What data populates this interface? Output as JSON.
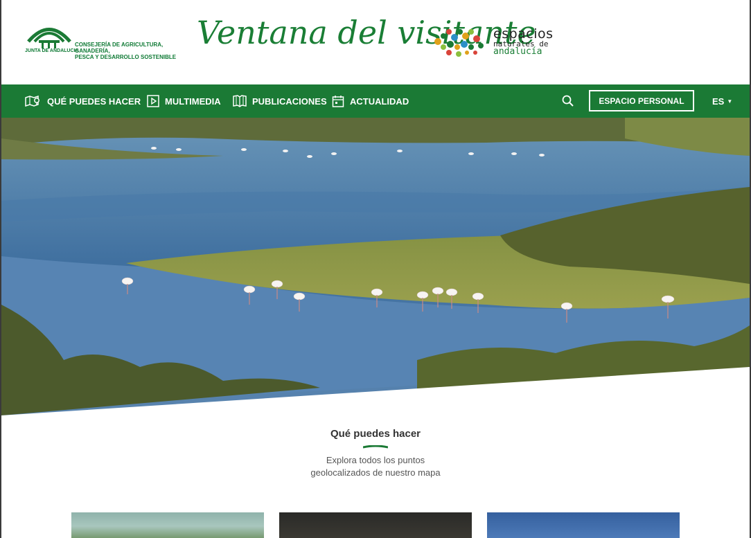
{
  "header": {
    "junta_logo_text": "JUNTA DE ANDALUCIA",
    "consejeria_line1": "CONSEJERÍA DE AGRICULTURA, GANADERÍA,",
    "consejeria_line2": "PESCA Y DESARROLLO SOSTENIBLE",
    "site_title": "Ventana del visitante",
    "espacios_line1": "espacios",
    "espacios_line2": "naturales de",
    "espacios_line3": "andalucía"
  },
  "nav": {
    "items": [
      {
        "label": "QUÉ PUEDES HACER",
        "icon": "map-pin-icon"
      },
      {
        "label": "MULTIMEDIA",
        "icon": "play-icon"
      },
      {
        "label": "PUBLICACIONES",
        "icon": "book-icon"
      },
      {
        "label": "ACTUALIDAD",
        "icon": "calendar-icon"
      }
    ],
    "search_icon": "search-icon",
    "espacio_personal": "ESPACIO PERSONAL",
    "language": "ES"
  },
  "hero": {
    "image": "lagoon-flamingos-photo"
  },
  "section": {
    "title": "Qué puedes hacer",
    "desc_line1": "Explora todos los puntos",
    "desc_line2": "geolocalizados de nuestro mapa"
  },
  "colors": {
    "brand_green": "#1b7a35",
    "text_dark": "#333333",
    "white": "#ffffff"
  }
}
